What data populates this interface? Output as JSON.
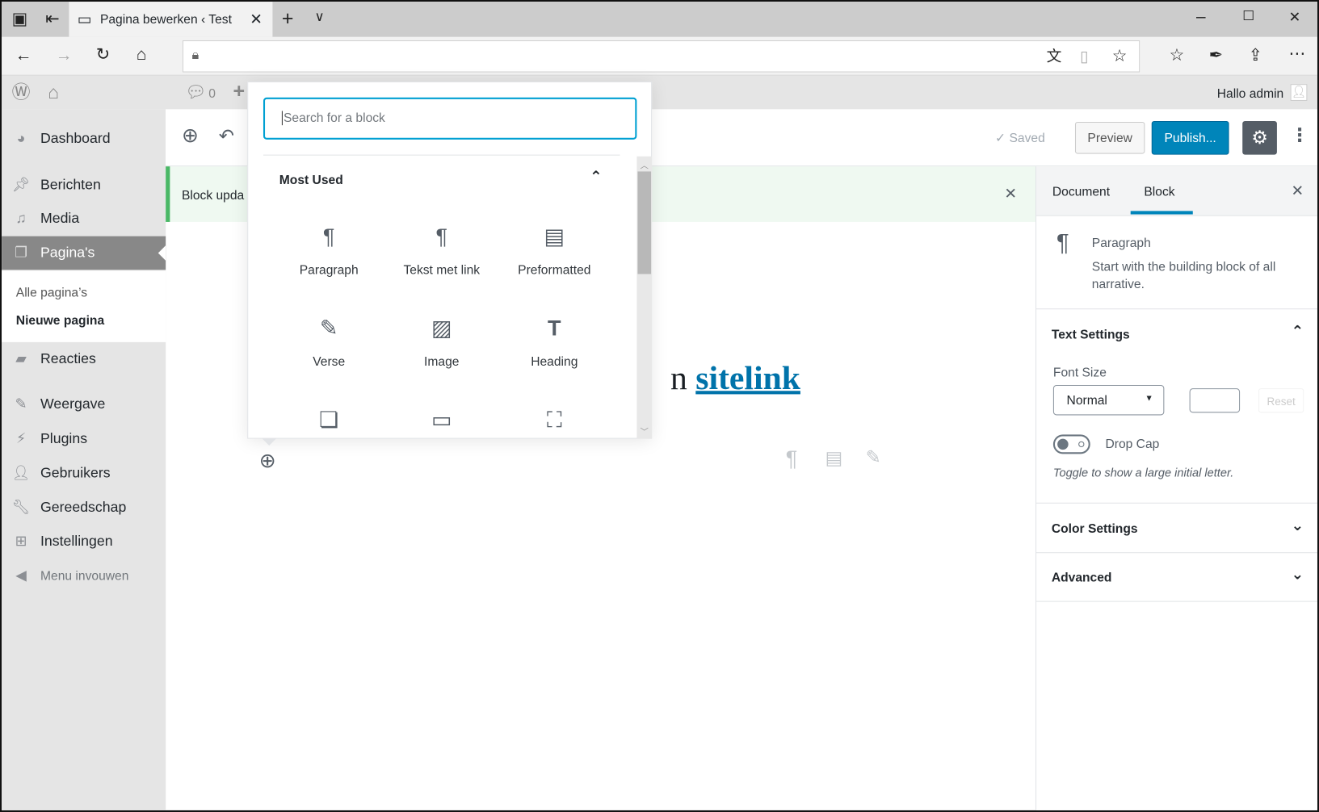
{
  "browser": {
    "tab_title": "Pagina bewerken ‹ Test",
    "address": ""
  },
  "adminbar": {
    "comments_count": "0",
    "greeting": "Hallo admin"
  },
  "sidebar": {
    "items": [
      {
        "label": "Dashboard",
        "icon": "dashboard-icon"
      },
      {
        "label": "Berichten",
        "icon": "pin-icon"
      },
      {
        "label": "Media",
        "icon": "media-icon"
      },
      {
        "label": "Pagina's",
        "icon": "pages-icon"
      },
      {
        "label": "Reacties",
        "icon": "comment-icon"
      },
      {
        "label": "Weergave",
        "icon": "brush-icon"
      },
      {
        "label": "Plugins",
        "icon": "plugin-icon"
      },
      {
        "label": "Gebruikers",
        "icon": "user-icon"
      },
      {
        "label": "Gereedschap",
        "icon": "wrench-icon"
      },
      {
        "label": "Instellingen",
        "icon": "settings-icon"
      },
      {
        "label": "Menu invouwen",
        "icon": "collapse-icon"
      }
    ],
    "submenu": [
      "Alle pagina’s",
      "Nieuwe pagina"
    ]
  },
  "header": {
    "saved": "Saved",
    "preview": "Preview",
    "publish": "Publish..."
  },
  "notice": {
    "text": "Block upda"
  },
  "content": {
    "text_before": "n ",
    "link": "sitelink"
  },
  "inserter": {
    "search_placeholder": "Search for a block",
    "section": "Most Used",
    "blocks": [
      {
        "label": "Paragraph",
        "icon": "paragraph-icon"
      },
      {
        "label": "Tekst met link",
        "icon": "paragraph-icon"
      },
      {
        "label": "Preformatted",
        "icon": "preformatted-icon"
      },
      {
        "label": "Verse",
        "icon": "pencil-icon"
      },
      {
        "label": "Image",
        "icon": "image-icon"
      },
      {
        "label": "Heading",
        "icon": "heading-icon"
      },
      {
        "label": "",
        "icon": "gallery-icon"
      },
      {
        "label": "",
        "icon": "button-icon"
      },
      {
        "label": "",
        "icon": "cover-image-icon"
      }
    ]
  },
  "panel": {
    "tabs": [
      "Document",
      "Block"
    ],
    "active_tab": "Block",
    "block_name": "Paragraph",
    "block_desc": "Start with the building block of all narrative.",
    "text_settings": "Text Settings",
    "font_size_label": "Font Size",
    "font_size": "Normal",
    "custom_size": "",
    "reset": "Reset",
    "drop_cap": "Drop Cap",
    "drop_cap_on": false,
    "drop_cap_help": "Toggle to show a large initial letter.",
    "color_settings": "Color Settings",
    "advanced": "Advanced"
  },
  "colors": {
    "accent": "#0085ba",
    "link": "#0073aa",
    "focus": "#00a0d2",
    "notice": "#4ab866"
  }
}
